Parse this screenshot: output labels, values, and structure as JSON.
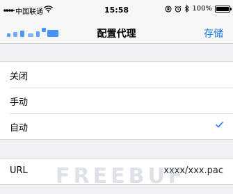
{
  "status_bar": {
    "carrier": "中国联通",
    "time": "15:58",
    "battery_text": "100%",
    "battery_level": 1.0,
    "icons": [
      "signal-icon",
      "wifi-icon",
      "orientation-lock-icon",
      "alarm-icon",
      "bluetooth-icon",
      "battery-icon"
    ]
  },
  "nav": {
    "title": "配置代理",
    "save_label": "存储",
    "accent_color": "#1a7bf2"
  },
  "proxy_options": [
    {
      "label": "关闭",
      "selected": false
    },
    {
      "label": "手动",
      "selected": false
    },
    {
      "label": "自动",
      "selected": true
    }
  ],
  "url_row": {
    "label": "URL",
    "value": "xxxx/xxx.pac"
  },
  "watermark": "FREEBUF"
}
